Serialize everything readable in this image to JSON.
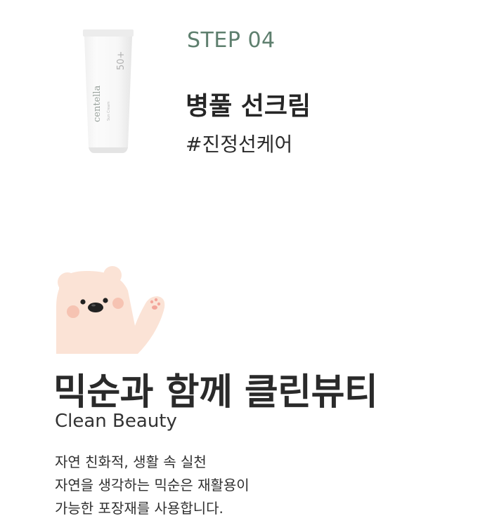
{
  "step": {
    "label": "STEP 04",
    "product_name": "병풀 선크림",
    "hashtag": "#진정선케어",
    "tube_brand": "centella",
    "tube_spf": "50+",
    "tube_type": "Sun Cream"
  },
  "clean_beauty": {
    "title": "믹순과 함께 클린뷰티",
    "subtitle": "Clean Beauty",
    "description": [
      "자연 친화적, 생활 속 실천",
      "자연을 생각하는 믹순은 재활용이",
      "가능한 포장재를 사용합니다."
    ]
  },
  "colors": {
    "step_accent": "#5e7f6e",
    "bear_fill": "#fbe3d6",
    "bear_cheek": "#f6c3b2"
  },
  "icons": {
    "product": "sunscreen-tube-icon",
    "mascot": "waving-bear-icon"
  }
}
